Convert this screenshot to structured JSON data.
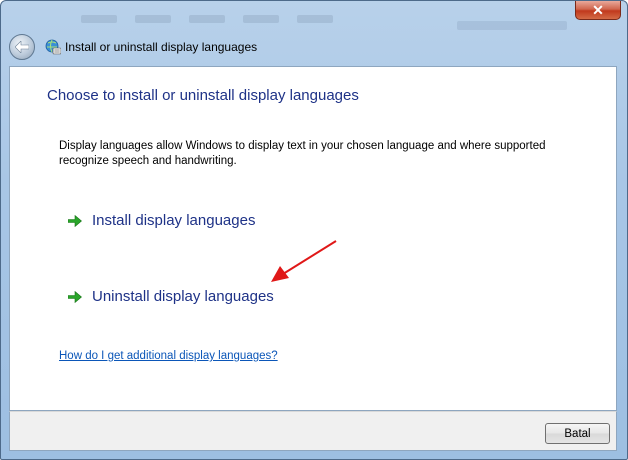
{
  "window": {
    "title": "Install or uninstall display languages",
    "close_label": "✕"
  },
  "content": {
    "heading": "Choose to install or uninstall display languages",
    "description": "Display languages allow Windows to display text in your chosen language and where supported recognize speech and handwriting.",
    "tasks": [
      {
        "label": "Install display languages",
        "icon": "green-arrow-icon"
      },
      {
        "label": "Uninstall display languages",
        "icon": "green-arrow-icon"
      }
    ],
    "help_link": "How do I get additional display languages?"
  },
  "footer": {
    "cancel_label": "Batal"
  },
  "colors": {
    "heading": "#1e3287",
    "link": "#0b56b8",
    "task_arrow": "#2aa52a",
    "annotation_arrow": "#e01818"
  },
  "icons": [
    "back-arrow-icon",
    "globe-keyboard-icon",
    "close-icon",
    "green-arrow-icon",
    "red-pointer-arrow-icon"
  ]
}
